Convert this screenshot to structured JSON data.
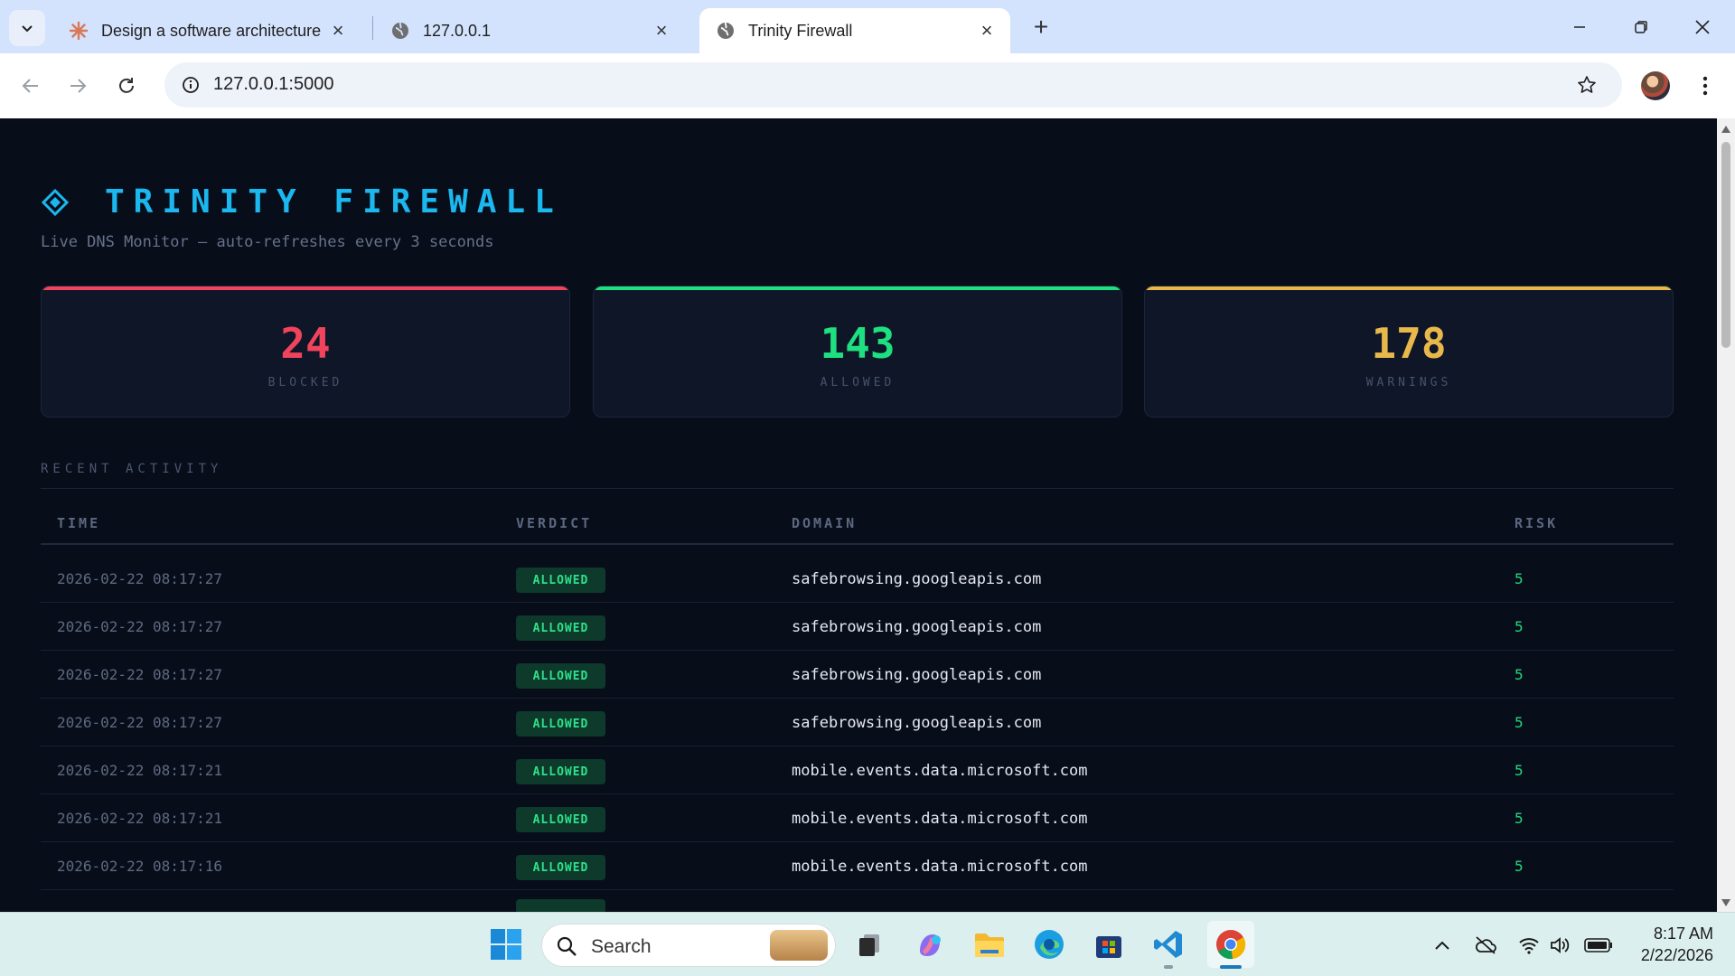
{
  "browser": {
    "tabs": [
      {
        "title": "Design a software architecture",
        "icon": "claude-icon"
      },
      {
        "title": "127.0.0.1",
        "icon": "globe-icon"
      },
      {
        "title": "Trinity Firewall",
        "icon": "globe-icon",
        "active": true
      }
    ],
    "url": "127.0.0.1:5000"
  },
  "header": {
    "brand_icon": "◈",
    "title": "TRINITY FIREWALL",
    "subtitle": "Live DNS Monitor — auto-refreshes every 3 seconds"
  },
  "stats": [
    {
      "value": "24",
      "label": "BLOCKED",
      "color": "#f0435c"
    },
    {
      "value": "143",
      "label": "ALLOWED",
      "color": "#1fe080"
    },
    {
      "value": "178",
      "label": "WARNINGS",
      "color": "#e8b84a"
    }
  ],
  "activity": {
    "section_title": "RECENT ACTIVITY",
    "columns": [
      "TIME",
      "VERDICT",
      "DOMAIN",
      "RISK"
    ],
    "rows": [
      {
        "time": "2026-02-22 08:17:27",
        "verdict": "ALLOWED",
        "domain": "safebrowsing.googleapis.com",
        "risk": "5"
      },
      {
        "time": "2026-02-22 08:17:27",
        "verdict": "ALLOWED",
        "domain": "safebrowsing.googleapis.com",
        "risk": "5"
      },
      {
        "time": "2026-02-22 08:17:27",
        "verdict": "ALLOWED",
        "domain": "safebrowsing.googleapis.com",
        "risk": "5"
      },
      {
        "time": "2026-02-22 08:17:27",
        "verdict": "ALLOWED",
        "domain": "safebrowsing.googleapis.com",
        "risk": "5"
      },
      {
        "time": "2026-02-22 08:17:21",
        "verdict": "ALLOWED",
        "domain": "mobile.events.data.microsoft.com",
        "risk": "5"
      },
      {
        "time": "2026-02-22 08:17:21",
        "verdict": "ALLOWED",
        "domain": "mobile.events.data.microsoft.com",
        "risk": "5"
      },
      {
        "time": "2026-02-22 08:17:16",
        "verdict": "ALLOWED",
        "domain": "mobile.events.data.microsoft.com",
        "risk": "5"
      }
    ]
  },
  "taskbar": {
    "search_label": "Search",
    "time": "8:17 AM",
    "date": "2/22/2026"
  }
}
